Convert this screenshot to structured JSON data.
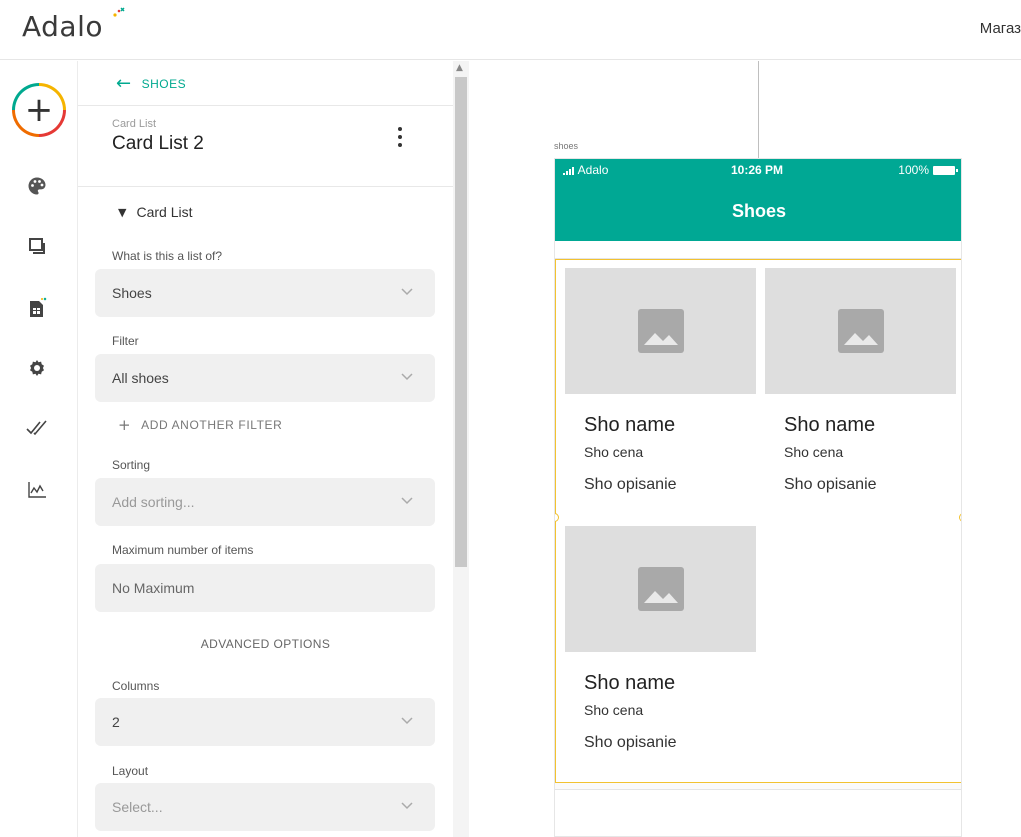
{
  "topbar": {
    "logo_text": "Adalo",
    "project_name": "Магаз"
  },
  "rail": {
    "items": [
      {
        "icon": "add-icon",
        "label": ""
      },
      {
        "icon": "palette-icon",
        "label": ""
      },
      {
        "icon": "screens-icon",
        "label": ""
      },
      {
        "icon": "database-icon",
        "label": ""
      },
      {
        "icon": "settings-gear-icon",
        "label": ""
      },
      {
        "icon": "publish-checks-icon",
        "label": ""
      },
      {
        "icon": "analytics-icon",
        "label": ""
      }
    ]
  },
  "panel": {
    "back_label": "SHOES",
    "component_type": "Card List",
    "component_name": "Card List 2",
    "section_title": "Card List",
    "fields": {
      "list_of": {
        "label": "What is this a list of?",
        "value": "Shoes"
      },
      "filter": {
        "label": "Filter",
        "value": "All shoes"
      },
      "add_filter": "ADD ANOTHER FILTER",
      "sorting": {
        "label": "Sorting",
        "placeholder": "Add sorting..."
      },
      "max_items": {
        "label": "Maximum number of items",
        "value": "No Maximum"
      },
      "advanced": "ADVANCED OPTIONS",
      "columns": {
        "label": "Columns",
        "value": "2"
      },
      "layout": {
        "label": "Layout",
        "placeholder": "Select..."
      }
    }
  },
  "canvas": {
    "screen_label": "shoes",
    "status": {
      "carrier": "Adalo",
      "time": "10:26 PM",
      "battery": "100%"
    },
    "app_title": "Shoes",
    "cards": [
      {
        "title": "Sho name",
        "subtitle": "Sho cena",
        "description": "Sho opisanie"
      },
      {
        "title": "Sho name",
        "subtitle": "Sho cena",
        "description": "Sho opisanie"
      },
      {
        "title": "Sho name",
        "subtitle": "Sho cena",
        "description": "Sho opisanie"
      }
    ]
  },
  "colors": {
    "accent": "#00a98f",
    "selection": "#f2c230"
  }
}
